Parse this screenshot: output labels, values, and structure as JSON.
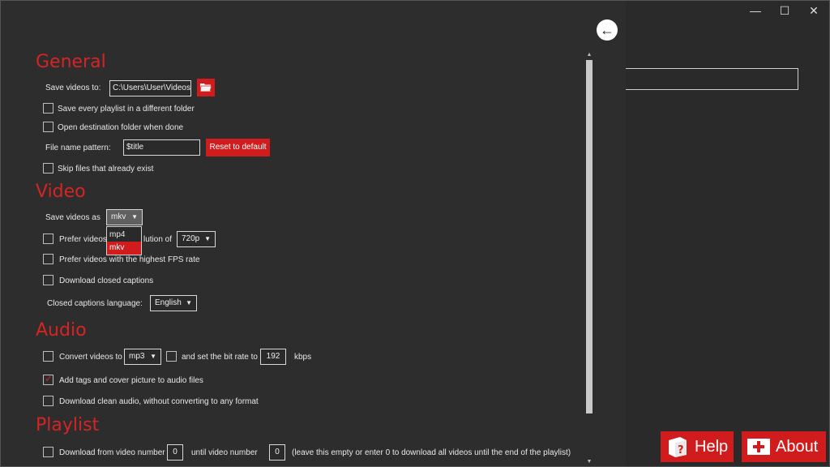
{
  "window": {
    "minimize": "—",
    "maximize": "☐",
    "close": "✕"
  },
  "general": {
    "title": "General",
    "save_videos_label": "Save videos to:",
    "save_path": "C:\\Users\\User\\Videos",
    "every_playlist_label": "Save every playlist in a different folder",
    "open_dest_label": "Open destination folder when done",
    "pattern_label": "File name pattern:",
    "pattern_value": "$title",
    "reset_label": "Reset to default",
    "skip_label": "Skip files that already exist"
  },
  "video": {
    "title": "Video",
    "save_as_label": "Save videos as",
    "format_value": "mkv",
    "format_options": [
      "mp4",
      "mkv"
    ],
    "prefer_res_label_a": "Prefer videos",
    "prefer_res_label_b": "lution of",
    "resolution_value": "720p",
    "fps_label": "Prefer videos with the highest FPS rate",
    "captions_label": "Download closed captions",
    "captions_lang_label": "Closed captions language:",
    "captions_lang_value": "English"
  },
  "audio": {
    "title": "Audio",
    "convert_label": "Convert videos to",
    "convert_value": "mp3",
    "bitrate_label": "and set the bit rate to",
    "bitrate_value": "192",
    "bitrate_unit": "kbps",
    "tags_label": "Add tags and cover picture to audio files",
    "clean_audio_label": "Download clean audio, without converting to any format"
  },
  "playlist": {
    "title": "Playlist",
    "from_label": "Download from video number",
    "from_value": "0",
    "until_label": "until video number",
    "until_value": "0",
    "note": "(leave this empty or enter 0 to download all videos until the end of the playlist)"
  },
  "buttons": {
    "help": "Help",
    "about": "About"
  },
  "colors": {
    "accent": "#d01c1c",
    "background": "#2d2d2d"
  }
}
